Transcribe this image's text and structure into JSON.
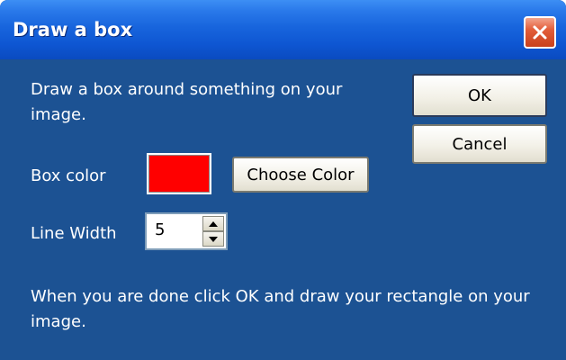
{
  "window": {
    "title": "Draw a box"
  },
  "dialog": {
    "instruction": "Draw a box around something on your image.",
    "box_color_label": "Box color",
    "box_color_value": "#ff0000",
    "choose_color_label": "Choose Color",
    "line_width_label": "Line Width",
    "line_width_value": "5",
    "footer_text": "When you are done click OK and draw your rectangle on your image."
  },
  "buttons": {
    "ok": "OK",
    "cancel": "Cancel"
  },
  "icons": {
    "close": "close-icon",
    "spin_up": "triangle-up-icon",
    "spin_down": "triangle-down-icon"
  },
  "colors": {
    "title_bar": "#0e56d2",
    "background": "#1c5293",
    "close_button": "#e35e3a"
  }
}
